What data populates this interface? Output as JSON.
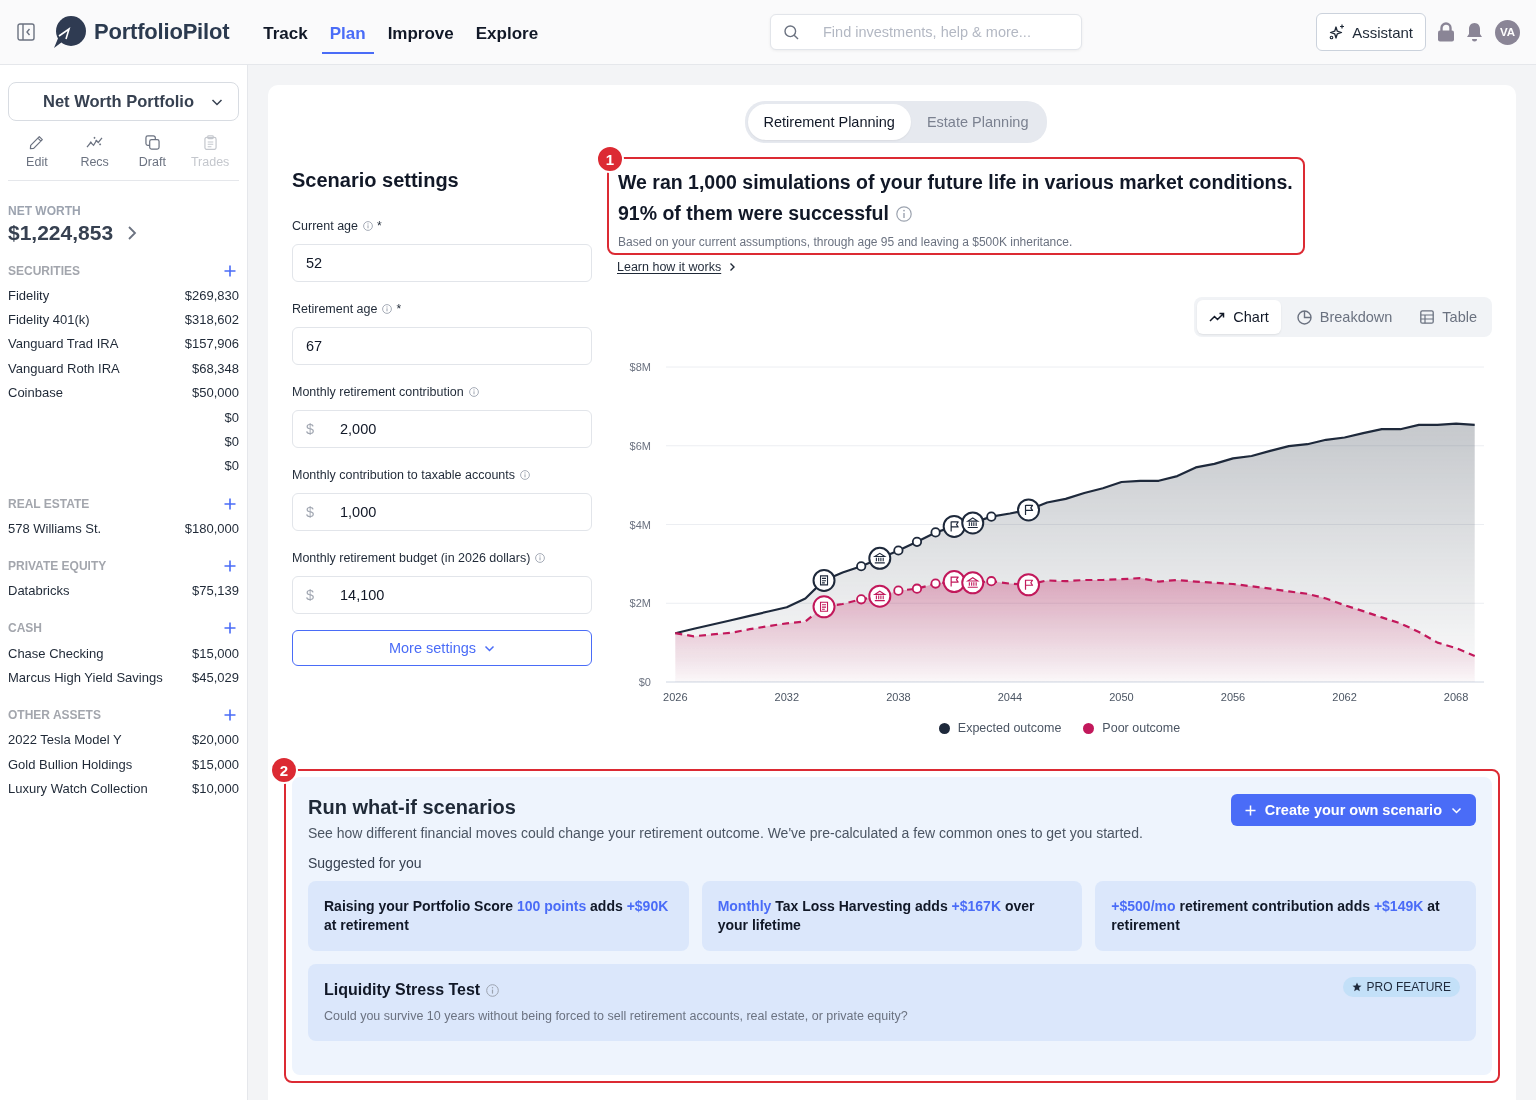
{
  "top_bar": {
    "logo_text": "PortfolioPilot",
    "nav": [
      {
        "label": "Track",
        "selected": false
      },
      {
        "label": "Plan",
        "selected": true
      },
      {
        "label": "Improve",
        "selected": false
      },
      {
        "label": "Explore",
        "selected": false
      }
    ],
    "search": {
      "placeholder": "Find investments, help & more..."
    },
    "assistant_button": "Assistant",
    "avatar": "VA"
  },
  "sidebar": {
    "portfolio_selector": "Net Worth Portfolio",
    "actions": [
      {
        "label": "Edit",
        "disabled": false
      },
      {
        "label": "Recs",
        "disabled": false
      },
      {
        "label": "Draft",
        "disabled": false
      },
      {
        "label": "Trades",
        "disabled": true
      }
    ],
    "net_worth": {
      "label": "NET WORTH",
      "value": "$1,224,853"
    },
    "groups": [
      {
        "title": "SECURITIES",
        "rows": [
          {
            "name": "Fidelity",
            "value": "$269,830"
          },
          {
            "name": "Fidelity 401(k)",
            "value": "$318,602"
          },
          {
            "name": "Vanguard Trad IRA",
            "value": "$157,906"
          },
          {
            "name": "Vanguard Roth IRA",
            "value": "$68,348"
          },
          {
            "name": "Coinbase",
            "value": "$50,000"
          },
          {
            "value": "$0"
          },
          {
            "value": "$0"
          },
          {
            "value": "$0"
          }
        ]
      },
      {
        "title": "REAL ESTATE",
        "rows": [
          {
            "name": "578 Williams St.",
            "value": "$180,000"
          }
        ]
      },
      {
        "title": "PRIVATE EQUITY",
        "rows": [
          {
            "name": "Databricks",
            "value": "$75,139"
          }
        ]
      },
      {
        "title": "CASH",
        "rows": [
          {
            "name": "Chase Checking",
            "value": "$15,000"
          },
          {
            "name": "Marcus High Yield Savings",
            "value": "$45,029"
          }
        ]
      },
      {
        "title": "OTHER ASSETS",
        "rows": [
          {
            "name": "2022 Tesla Model Y",
            "value": "$20,000"
          },
          {
            "name": "Gold Bullion Holdings",
            "value": "$15,000"
          },
          {
            "name": "Luxury Watch Collection",
            "value": "$10,000"
          }
        ]
      }
    ]
  },
  "plan_tabs": [
    {
      "label": "Retirement Planning",
      "selected": true
    },
    {
      "label": "Estate Planning",
      "selected": false
    }
  ],
  "scenario_settings": {
    "title": "Scenario settings",
    "fields": [
      {
        "label": "Current age",
        "required_mark": "*",
        "value": "52"
      },
      {
        "label": "Retirement age",
        "required_mark": "*",
        "value": "67"
      },
      {
        "label": "Monthly retirement contribution",
        "prefix": "$",
        "value": "2,000"
      },
      {
        "label": "Monthly contribution to taxable accounts",
        "prefix": "$",
        "value": "1,000"
      },
      {
        "label": "Monthly retirement budget (in 2026 dollars)",
        "prefix": "$",
        "value": "14,100"
      }
    ],
    "more_button": "More settings"
  },
  "result": {
    "callout": "1",
    "headline": "We ran 1,000 simulations of your future life in various market conditions.",
    "success_line": "91% of them were successful",
    "note": "Based on your current assumptions, through age 95 and leaving a $500K inheritance.",
    "link": "Learn how it works"
  },
  "chart": {
    "views": [
      {
        "label": "Chart",
        "selected": true
      },
      {
        "label": "Breakdown",
        "selected": false
      },
      {
        "label": "Table",
        "selected": false
      }
    ],
    "chart_data": [
      {
        "type": "area",
        "x": [
          2026,
          2027,
          2028,
          2029,
          2030,
          2031,
          2032,
          2033,
          2034,
          2035,
          2036,
          2037,
          2038,
          2039,
          2040,
          2041,
          2042,
          2043,
          2044,
          2045,
          2046,
          2047,
          2048,
          2049,
          2050,
          2051,
          2052,
          2053,
          2054,
          2055,
          2056,
          2057,
          2058,
          2059,
          2060,
          2061,
          2062,
          2063,
          2064,
          2065,
          2066,
          2067,
          2068,
          2069
        ],
        "xlim": [
          2025.5,
          2069.5
        ],
        "xticks": [
          2026,
          2032,
          2038,
          2044,
          2050,
          2056,
          2062,
          2068
        ],
        "ylim": [
          0,
          8
        ],
        "yticks": [
          {
            "value": 0,
            "label": "$0"
          },
          {
            "value": 2,
            "label": "$2M"
          },
          {
            "value": 4,
            "label": "$4M"
          },
          {
            "value": 6,
            "label": "$6M"
          },
          {
            "value": 8,
            "label": "$8M"
          }
        ],
        "grid": true,
        "legend": "bottom",
        "series": [
          {
            "name": "Expected outcome",
            "color": "#1e293b",
            "line_style": "solid",
            "values": [
              1.24,
              1.35,
              1.46,
              1.57,
              1.68,
              1.79,
              1.9,
              2.12,
              2.58,
              2.78,
              2.94,
              3.14,
              3.34,
              3.56,
              3.8,
              3.95,
              4.04,
              4.2,
              4.28,
              4.37,
              4.56,
              4.65,
              4.8,
              4.92,
              5.08,
              5.11,
              5.11,
              5.23,
              5.45,
              5.54,
              5.68,
              5.74,
              5.87,
              5.99,
              6.04,
              6.15,
              6.21,
              6.32,
              6.42,
              6.42,
              6.53,
              6.53,
              6.56,
              6.53
            ]
          },
          {
            "name": "Poor outcome",
            "color": "#c2185b",
            "line_style": "dashed",
            "values": [
              1.24,
              1.16,
              1.21,
              1.25,
              1.34,
              1.42,
              1.49,
              1.54,
              1.91,
              1.98,
              2.1,
              2.18,
              2.32,
              2.37,
              2.5,
              2.55,
              2.52,
              2.56,
              2.5,
              2.47,
              2.58,
              2.56,
              2.59,
              2.59,
              2.61,
              2.64,
              2.55,
              2.59,
              2.55,
              2.52,
              2.49,
              2.43,
              2.37,
              2.3,
              2.24,
              2.12,
              1.95,
              1.8,
              1.64,
              1.49,
              1.27,
              1.0,
              0.86,
              0.66
            ]
          },
          {
            "type": "scatter",
            "marker": "circle",
            "color": "#1e293b",
            "x": [
              2036,
              2038,
              2039,
              2040,
              2043
            ],
            "values": [
              2.94,
              3.34,
              3.56,
              3.8,
              4.2
            ]
          },
          {
            "type": "scatter",
            "marker": "circle",
            "color": "#c2185b",
            "x": [
              2036,
              2038,
              2039,
              2040,
              2043
            ],
            "values": [
              2.1,
              2.32,
              2.37,
              2.5,
              2.56
            ]
          },
          {
            "type": "scatter",
            "color": "#1e293b",
            "x": [
              2034,
              2037,
              2041,
              2042,
              2045
            ],
            "values": [
              2.58,
              3.14,
              3.95,
              4.04,
              4.37
            ]
          },
          {
            "type": "scatter",
            "color": "#c2185b",
            "x": [
              2034,
              2037,
              2041,
              2042,
              2045
            ],
            "values": [
              1.91,
              2.18,
              2.55,
              2.52,
              2.47
            ]
          }
        ]
      }
    ]
  },
  "what_if": {
    "callout": "2",
    "title": "Run what-if scenarios",
    "subtitle": "See how different financial moves could change your retirement outcome. We've pre-calculated a few common ones to get you started.",
    "create_button": "Create your own scenario",
    "suggested_label": "Suggested for you",
    "suggestions": [
      {
        "segments": [
          {
            "text": "Raising your Portfolio Score ",
            "highlight": false
          },
          {
            "text": "100 points",
            "highlight": true
          },
          {
            "text": " adds ",
            "highlight": false
          },
          {
            "text": "+$90K",
            "highlight": true
          },
          {
            "text": " at retirement",
            "highlight": false
          }
        ]
      },
      {
        "segments": [
          {
            "text": "Monthly",
            "highlight": true
          },
          {
            "text": " Tax Loss Harvesting adds ",
            "highlight": false
          },
          {
            "text": "+$167K",
            "highlight": true
          },
          {
            "text": " over your lifetime",
            "highlight": false
          }
        ]
      },
      {
        "segments": [
          {
            "text": "+$500/mo",
            "highlight": true
          },
          {
            "text": " retirement contribution adds ",
            "highlight": false
          },
          {
            "text": "+$149K",
            "highlight": true
          },
          {
            "text": " at retirement",
            "highlight": false
          }
        ]
      }
    ],
    "stress_test": {
      "title": "Liquidity Stress Test",
      "badge": "PRO FEATURE",
      "description": "Could you survive 10 years without being forced to sell retirement accounts, real estate, or private equity?"
    }
  }
}
